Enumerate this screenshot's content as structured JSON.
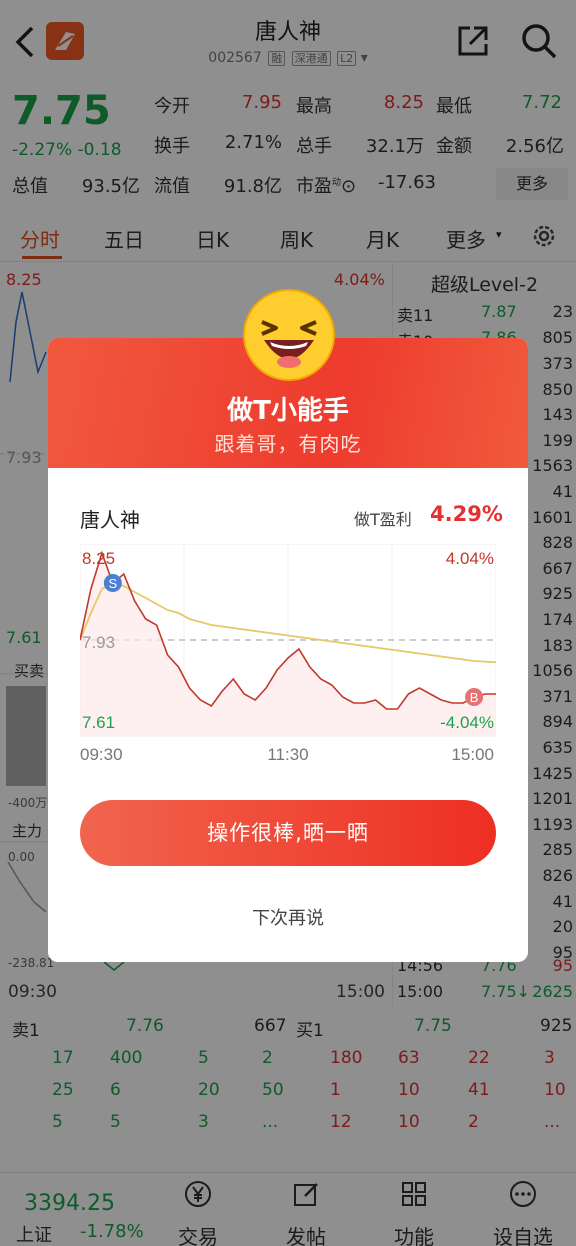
{
  "header": {
    "title": "唐人神",
    "code": "002567",
    "tags": [
      "融",
      "深港通",
      "L2"
    ]
  },
  "quote": {
    "price": "7.75",
    "change_pct": "-2.27%",
    "change": "-0.18",
    "open_label": "今开",
    "open": "7.95",
    "high_label": "最高",
    "high": "8.25",
    "low_label": "最低",
    "low": "7.72",
    "turnover_label": "换手",
    "turnover": "2.71%",
    "volume_label": "总手",
    "volume": "32.1万",
    "amount_label": "金额",
    "amount": "2.56亿",
    "mktcap_label": "总值",
    "mktcap": "93.5亿",
    "float_label": "流值",
    "float": "91.8亿",
    "pe_label": "市盈",
    "pe_sup": "动",
    "pe": "-17.63",
    "more_label": "更多"
  },
  "tabs": [
    "分时",
    "五日",
    "日K",
    "周K",
    "月K",
    "更多"
  ],
  "chart_bg": {
    "top_price": "8.25",
    "top_pct": "4.04%",
    "mid_price": "7.93",
    "low_price": "7.61",
    "trade_label": "买卖",
    "vol_label": "-400万",
    "main_label": "主力",
    "main_val": "0.00",
    "main_min": "-238.81",
    "t_start": "09:30",
    "t_end": "15:00"
  },
  "level2": {
    "title": "超级Level-2",
    "rows": [
      {
        "label": "卖11",
        "price": "7.87",
        "vol": "23"
      },
      {
        "label": "卖10",
        "price": "7.86",
        "vol": "805"
      }
    ],
    "vols": [
      "373",
      "850",
      "143",
      "199",
      "1563",
      "41",
      "1601",
      "828",
      "667",
      "925",
      "174",
      "183",
      "1056",
      "371",
      "894",
      "635",
      "1425",
      "1201",
      "1193",
      "285",
      "826",
      "41",
      "20",
      "95"
    ],
    "tick1": {
      "time": "14:56",
      "price": "7.76",
      "vol": "95"
    },
    "tick2": {
      "time": "15:00",
      "price": "7.75↓",
      "vol": "2625"
    }
  },
  "book": {
    "sell1_label": "卖1",
    "sell1_price": "7.76",
    "sell1_vol": "667",
    "buy1_label": "买1",
    "buy1_price": "7.75",
    "buy1_vol": "925",
    "sell_rows": [
      [
        "17",
        "400",
        "5",
        "2"
      ],
      [
        "25",
        "6",
        "20",
        "50"
      ],
      [
        "5",
        "5",
        "3",
        "..."
      ]
    ],
    "buy_rows": [
      [
        "180",
        "63",
        "22",
        "3"
      ],
      [
        "1",
        "10",
        "41",
        "10"
      ],
      [
        "12",
        "10",
        "2",
        "..."
      ]
    ]
  },
  "bottom_nav": {
    "index_value": "3394.25",
    "index_name": "上证",
    "index_change": "-1.78%",
    "items": [
      "交易",
      "发帖",
      "功能",
      "设自选"
    ]
  },
  "modal": {
    "title": "做T小能手",
    "subtitle": "跟着哥，有肉吃",
    "stock_name": "唐人神",
    "profit_label": "做T盈利",
    "profit_value": "4.29%",
    "cta_label": "操作很棒,晒一晒",
    "later_label": "下次再说"
  },
  "chart_data": {
    "type": "line",
    "x_ticks": [
      "09:30",
      "11:30",
      "15:00"
    ],
    "y_left_ticks": [
      "8.25",
      "7.93",
      "7.61"
    ],
    "y_right_ticks": [
      "4.04%",
      "-4.04%"
    ],
    "ylim": [
      7.61,
      8.25
    ],
    "baseline": 7.93,
    "markers": [
      {
        "label": "S",
        "series": "price"
      },
      {
        "label": "B",
        "series": "price"
      }
    ],
    "series": [
      {
        "values": [
          7.93,
          8.1,
          8.22,
          8.12,
          8.15,
          8.06,
          8.0,
          7.98,
          7.88,
          7.84,
          7.77,
          7.73,
          7.71,
          7.76,
          7.8,
          7.75,
          7.73,
          7.77,
          7.83,
          7.87,
          7.9,
          7.84,
          7.8,
          7.78,
          7.74,
          7.72,
          7.72,
          7.73,
          7.7,
          7.7,
          7.75,
          7.77,
          7.75,
          7.73,
          7.72,
          7.72,
          7.74,
          7.75,
          7.75
        ]
      },
      {
        "values": [
          7.93,
          8.02,
          8.1,
          8.12,
          8.11,
          8.09,
          8.07,
          8.05,
          8.03,
          8.02,
          8.0,
          7.99,
          7.98,
          7.975,
          7.97,
          7.965,
          7.96,
          7.955,
          7.95,
          7.945,
          7.94,
          7.935,
          7.93,
          7.925,
          7.92,
          7.915,
          7.91,
          7.905,
          7.9,
          7.895,
          7.89,
          7.885,
          7.88,
          7.875,
          7.87,
          7.865,
          7.86,
          7.858,
          7.856
        ]
      }
    ]
  }
}
